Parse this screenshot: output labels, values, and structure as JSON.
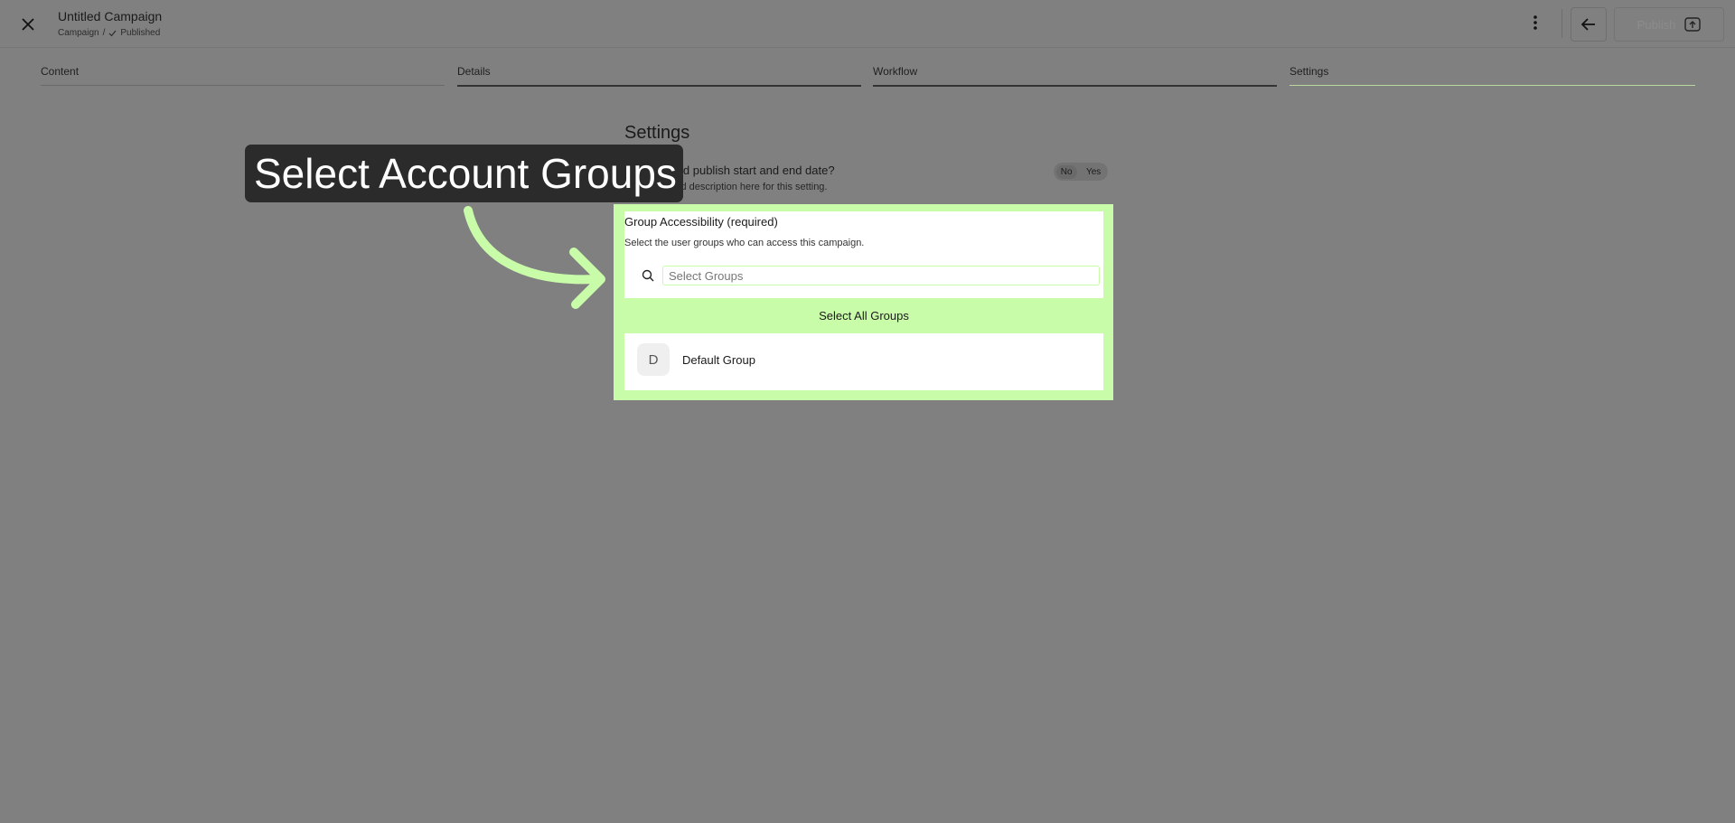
{
  "header": {
    "title": "Untitled Campaign",
    "breadcrumb_parent": "Campaign",
    "breadcrumb_sep": "/",
    "status": "Published",
    "publish_label": "Publish"
  },
  "tabs": [
    {
      "label": "Content"
    },
    {
      "label": "Details"
    },
    {
      "label": "Workflow"
    },
    {
      "label": "Settings"
    }
  ],
  "settings": {
    "heading": "Settings",
    "question": "Add publish start and end date?",
    "description": "Add description here for this setting.",
    "toggle_no": "No",
    "toggle_yes": "Yes"
  },
  "tooltip": {
    "text": "Select Account Groups"
  },
  "group_access": {
    "title": "Group Accessibility (required)",
    "description": "Select the user groups who can access this campaign.",
    "search_placeholder": "Select Groups",
    "select_all": "Select All Groups",
    "groups": [
      {
        "initial": "D",
        "name": "Default Group"
      }
    ]
  },
  "colors": {
    "overlay": "#808080",
    "highlight": "#c9fca9",
    "tooltip_bg": "#2b2b2b"
  }
}
